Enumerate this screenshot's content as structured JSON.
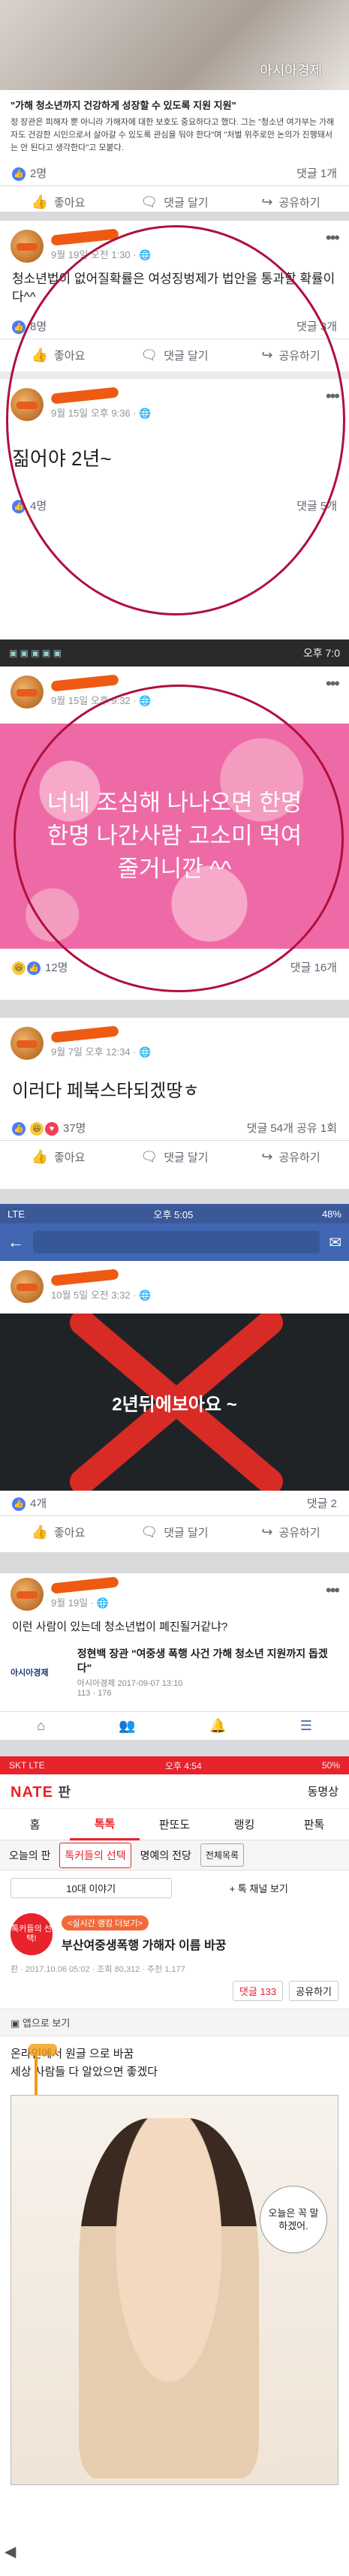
{
  "post1": {
    "watermark": "아시아경제",
    "caption": "\"가해 청소년까지 건강하게 성장할 수 있도록 지원 지원\"",
    "body": "정 장관은 피해자 뿐 아니라 가해자에 대한 보호도 중요하다고 했다. 그는 \"청소년 여가부는 가해자도 건강한 시민으로서 살아갈 수 있도록 관심을 둬야 한다\"며 \"처벌 위주로만 논의가 진행돼서는 안 된다고 생각한다\"고 모붙다.",
    "likes": "2명",
    "comments": "댓글 1개",
    "like_label": "좋아요",
    "comment_label": "댓글 달기",
    "share_label": "공유하기"
  },
  "post2": {
    "time": "9월 19일 오전 1:30 · ",
    "text": "청소년법이 없어질확률은 여성징벙제가 법안을 통과할 확률이다^^",
    "likes": "8명",
    "comments": "댓글 3개",
    "like_label": "좋아요",
    "comment_label": "댓글 달기",
    "share_label": "공유하기"
  },
  "post3": {
    "time": "9월 15일 오후 9:36 · ",
    "text": "짊어야 2년~",
    "likes": "4명",
    "comments": "댓글 5개"
  },
  "status1": {
    "time": "오후 7:0"
  },
  "post4": {
    "time": "9월 15일 오후 9:32 · ",
    "image_text": "너네 조심해 나나오면 한명한명 나간사람 고소미 먹여줄거니깐 ^^",
    "likes": "12명",
    "comments": "댓글 16개"
  },
  "post5": {
    "time": "9월 7일 오후 12:34 · ",
    "text": "이러다 페북스타되겠땅ㅎ",
    "likes": "37명",
    "comments": "댓글 54개",
    "shares": "공유 1회",
    "like_label": "좋아요",
    "comment_label": "댓글 달기",
    "share_label": "공유하기"
  },
  "fb_status": {
    "carrier": "LTE",
    "time": "오후 5:05",
    "battery": "48%"
  },
  "post6": {
    "time": "10월 5일 오전 3:32 · ",
    "image_text": "2년뒤에보아요 ~",
    "likes": "4개",
    "comments": "댓글 2",
    "like_label": "좋아요",
    "comment_label": "댓글 달기",
    "share_label": "공유하기"
  },
  "post7": {
    "time": "9월 19일 · ",
    "text": "이런 사람이 있는데 청소년법이 폐진될거같냐?",
    "source": "아시아경제",
    "link_title": "정현백 장관 \"여중생 폭행 사건 가해 청소년 지원까지 돕겠다\"",
    "link_meta": "아시아경제 2017-09-07 13:10",
    "link_stats": "113 · 176"
  },
  "nate_status": {
    "carrier": "SKT LTE",
    "time": "오후 4:54",
    "battery": "50%"
  },
  "nate": {
    "logo": "NATE",
    "logo_sub": "판",
    "community": "동명상",
    "tabs": [
      "홈",
      "톡톡",
      "판또도",
      "랭킹",
      "판톡"
    ],
    "subtabs": [
      "오늘의 판",
      "톡커들의 선택",
      "명예의 전당",
      "전체목록"
    ],
    "ranking_btn": "10대 이야기",
    "channel_btn": "+ 톡 채널 보기",
    "badge": "톡커들의 선택!",
    "tag": "<실시간 랭킹 더보기>",
    "title": "부산여중생폭행 가해자 이름 바꿍",
    "meta": "판 · 2017.10.06 05:02 · 조회 80,312 · 추천 1,177",
    "comment_count": "댓글 133",
    "share": "공유하기",
    "app_view": "앱으로 보기",
    "body1": "온라인에서 원글 으로 바꿈",
    "body2": "세상 사람들 다 알았으면 좋겠다",
    "manga_bubble": "오늘은 꼭 말하겠어."
  }
}
